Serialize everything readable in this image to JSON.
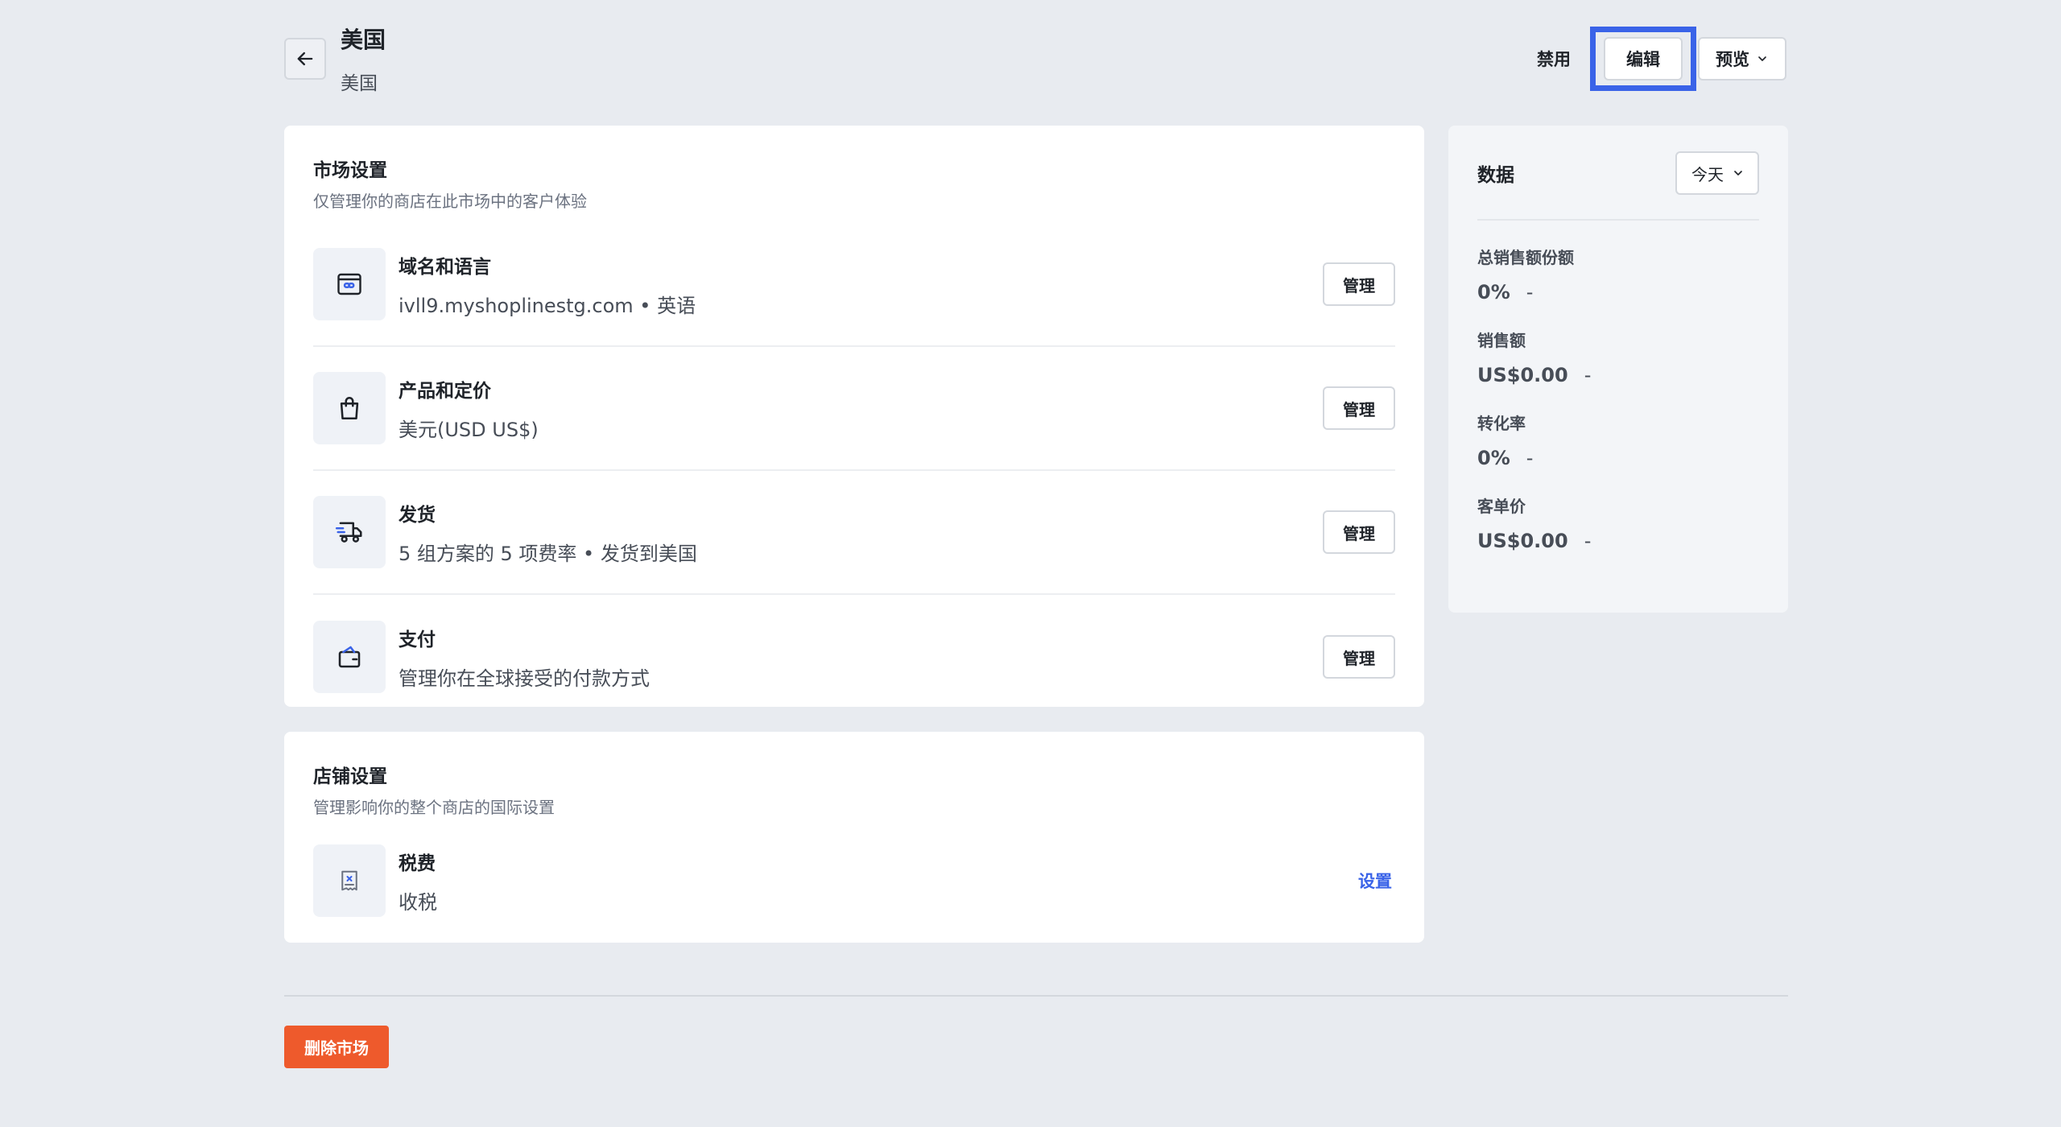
{
  "header": {
    "title": "美国",
    "subtitle": "美国",
    "disable_label": "禁用",
    "edit_label": "编辑",
    "preview_label": "预览"
  },
  "market_settings": {
    "title": "市场设置",
    "description": "仅管理你的商店在此市场中的客户体验",
    "items": [
      {
        "icon": "domain-icon",
        "title": "域名和语言",
        "subtitle": "ivll9.myshoplinestg.com • 英语",
        "action": "管理"
      },
      {
        "icon": "shopping-bag-icon",
        "title": "产品和定价",
        "subtitle": "美元(USD US$)",
        "action": "管理"
      },
      {
        "icon": "delivery-truck-icon",
        "title": "发货",
        "subtitle": "5 组方案的 5 项费率 • 发货到美国",
        "action": "管理"
      },
      {
        "icon": "wallet-icon",
        "title": "支付",
        "subtitle": "管理你在全球接受的付款方式",
        "action": "管理"
      }
    ]
  },
  "store_settings": {
    "title": "店铺设置",
    "description": "管理影响你的整个商店的国际设置",
    "items": [
      {
        "icon": "tax-receipt-icon",
        "title": "税费",
        "subtitle": "收税",
        "action": "设置"
      }
    ]
  },
  "data_panel": {
    "title": "数据",
    "range_label": "今天",
    "metrics": [
      {
        "label": "总销售额份额",
        "value": "0%",
        "trend": "-"
      },
      {
        "label": "销售额",
        "value": "US$0.00",
        "trend": "-"
      },
      {
        "label": "转化率",
        "value": "0%",
        "trend": "-"
      },
      {
        "label": "客单价",
        "value": "US$0.00",
        "trend": "-"
      }
    ]
  },
  "footer": {
    "delete_label": "删除市场"
  },
  "colors": {
    "accent": "#3a63e8",
    "danger": "#ee5a2c",
    "background": "#e8ebf0"
  }
}
